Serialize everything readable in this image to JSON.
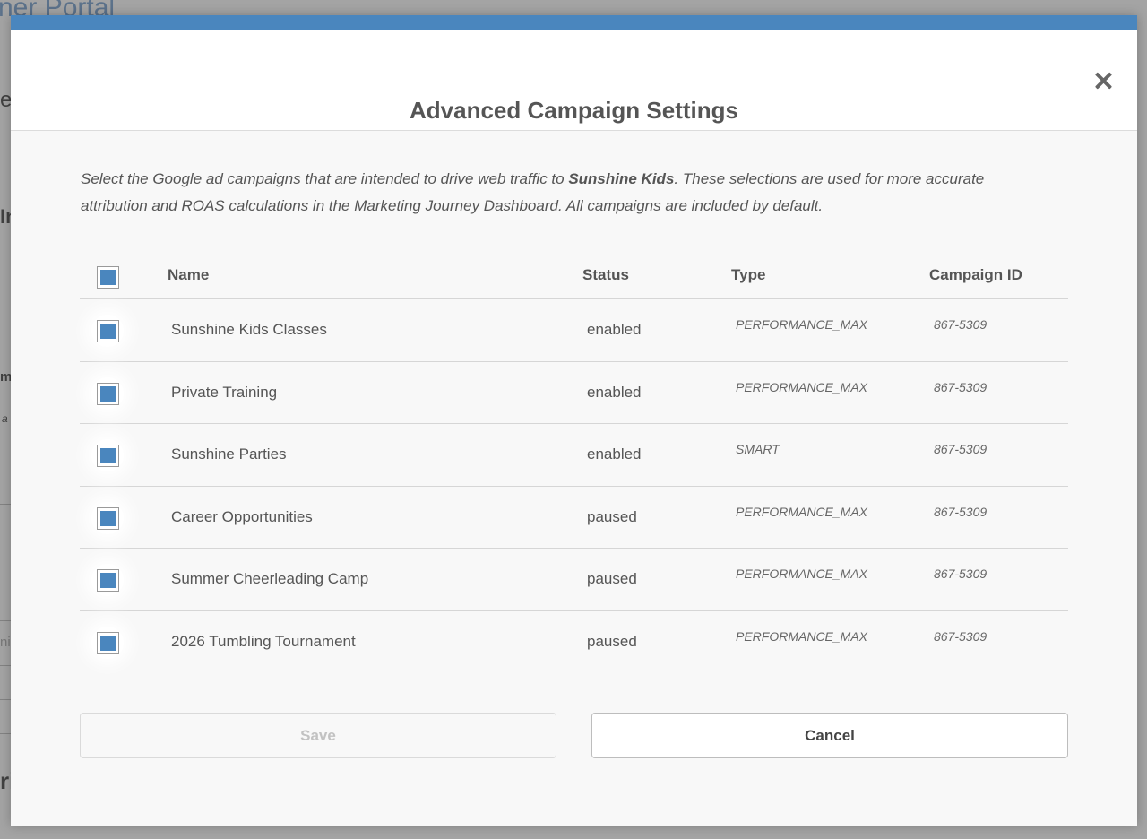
{
  "background": {
    "title_fragment": "ner Portal",
    "fragments": [
      "ey",
      "In",
      "m",
      "a",
      "ni",
      "ri"
    ]
  },
  "modal": {
    "title": "Advanced Campaign Settings",
    "close_icon": "close-icon",
    "description": {
      "before": "Select the Google ad campaigns that are intended to drive web traffic to ",
      "brand": "Sunshine Kids",
      "after": ". These selections are used for more accurate attribution and ROAS calculations in the Marketing Journey Dashboard. All campaigns are included by default."
    },
    "table": {
      "headers": {
        "name": "Name",
        "status": "Status",
        "type": "Type",
        "campaign_id": "Campaign ID"
      },
      "select_all_checked": true,
      "rows": [
        {
          "name": "Sunshine Kids Classes",
          "status": "enabled",
          "type": "PERFORMANCE_MAX",
          "campaign_id": "867-5309",
          "checked": true
        },
        {
          "name": "Private Training",
          "status": "enabled",
          "type": "PERFORMANCE_MAX",
          "campaign_id": "867-5309",
          "checked": true
        },
        {
          "name": "Sunshine Parties",
          "status": "enabled",
          "type": "SMART",
          "campaign_id": "867-5309",
          "checked": true
        },
        {
          "name": "Career Opportunities",
          "status": "paused",
          "type": "PERFORMANCE_MAX",
          "campaign_id": "867-5309",
          "checked": true
        },
        {
          "name": "Summer Cheerleading Camp",
          "status": "paused",
          "type": "PERFORMANCE_MAX",
          "campaign_id": "867-5309",
          "checked": true
        },
        {
          "name": "2026 Tumbling Tournament",
          "status": "paused",
          "type": "PERFORMANCE_MAX",
          "campaign_id": "867-5309",
          "checked": true
        }
      ]
    },
    "buttons": {
      "save": "Save",
      "cancel": "Cancel"
    },
    "colors": {
      "accent": "#4a86be",
      "text": "#555555"
    }
  }
}
